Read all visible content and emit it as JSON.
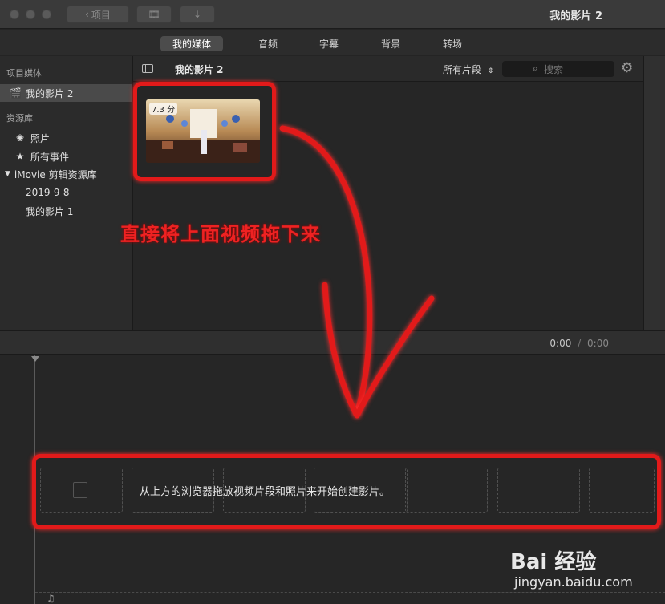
{
  "window": {
    "title": "我的影片 2",
    "back_label": "项目"
  },
  "tabs": [
    {
      "label": "我的媒体",
      "active": true
    },
    {
      "label": "音频",
      "active": false
    },
    {
      "label": "字幕",
      "active": false
    },
    {
      "label": "背景",
      "active": false
    },
    {
      "label": "转场",
      "active": false
    }
  ],
  "sidebar": {
    "project_header": "项目媒体",
    "project_item": "我的影片 2",
    "libraries_header": "资源库",
    "photos": "照片",
    "all_events": "所有事件",
    "library": "iMovie 剪辑资源库",
    "events": [
      "2019-9-8",
      "我的影片 1"
    ]
  },
  "browser": {
    "title": "我的影片 2",
    "filter": "所有片段",
    "search_placeholder": "搜索",
    "clip_duration": "7.3 分"
  },
  "timeline": {
    "current_time": "0:00",
    "separator": "/",
    "total_time": "0:00",
    "drop_hint": "从上方的浏览器拖放视频片段和照片来开始创建影片。"
  },
  "annotation": {
    "text": "直接将上面视频拖下来",
    "color": "#e21a1a"
  },
  "watermark": {
    "brand": "Bai 经验",
    "url": "jingyan.baidu.com"
  }
}
